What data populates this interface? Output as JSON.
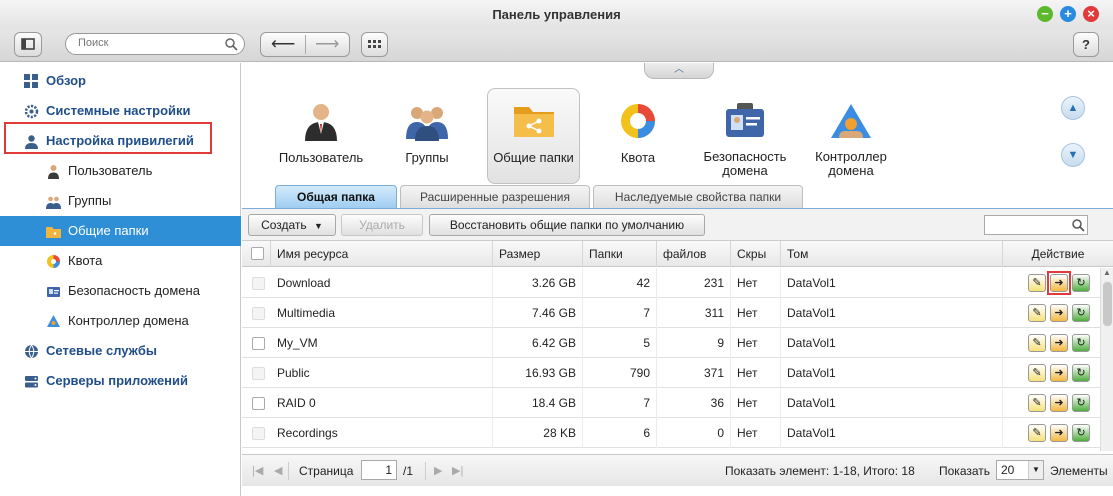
{
  "window": {
    "title": "Панель управления"
  },
  "toolbar": {
    "search_placeholder": "Поиск",
    "help_label": "?"
  },
  "sidebar": {
    "items": [
      {
        "label": "Обзор",
        "level": "top",
        "icon": "overview-grid-icon"
      },
      {
        "label": "Системные настройки",
        "level": "top",
        "icon": "gear-icon"
      },
      {
        "label": "Настройка привилегий",
        "level": "top",
        "icon": "user-icon",
        "highlighted": true
      },
      {
        "label": "Пользователь",
        "level": "sub",
        "icon": "user-icon"
      },
      {
        "label": "Группы",
        "level": "sub",
        "icon": "group-icon"
      },
      {
        "label": "Общие папки",
        "level": "sub",
        "icon": "shared-folder-icon",
        "active": true
      },
      {
        "label": "Квота",
        "level": "sub",
        "icon": "quota-pie-icon"
      },
      {
        "label": "Безопасность домена",
        "level": "sub",
        "icon": "domain-security-icon"
      },
      {
        "label": "Контроллер домена",
        "level": "sub",
        "icon": "domain-controller-icon"
      },
      {
        "label": "Сетевые службы",
        "level": "top",
        "icon": "globe-icon"
      },
      {
        "label": "Серверы приложений",
        "level": "top",
        "icon": "server-icon"
      }
    ]
  },
  "categories": [
    {
      "label": "Пользователь"
    },
    {
      "label": "Группы"
    },
    {
      "label": "Общие папки",
      "active": true
    },
    {
      "label": "Квота"
    },
    {
      "label_line1": "Безопасность",
      "label_line2": "домена"
    },
    {
      "label_line1": "Контроллер",
      "label_line2": "домена"
    }
  ],
  "tabs": [
    {
      "label": "Общая папка",
      "active": true
    },
    {
      "label": "Расширенные разрешения"
    },
    {
      "label": "Наследуемые свойства папки"
    }
  ],
  "actions": {
    "create_label": "Создать",
    "delete_label": "Удалить",
    "restore_label": "Восстановить общие папки по умолчанию"
  },
  "table": {
    "headers": [
      "Имя ресурса",
      "Размер",
      "Папки",
      "файлов",
      "Скры",
      "Том",
      "Действие"
    ],
    "rows": [
      {
        "name": "Download",
        "size": "3.26 GB",
        "folders": "42",
        "files": "231",
        "hidden": "Нет",
        "volume": "DataVol1",
        "checkbox_enabled": false
      },
      {
        "name": "Multimedia",
        "size": "7.46 GB",
        "folders": "7",
        "files": "311",
        "hidden": "Нет",
        "volume": "DataVol1",
        "checkbox_enabled": false
      },
      {
        "name": "My_VM",
        "size": "6.42 GB",
        "folders": "5",
        "files": "9",
        "hidden": "Нет",
        "volume": "DataVol1",
        "checkbox_enabled": true
      },
      {
        "name": "Public",
        "size": "16.93 GB",
        "folders": "790",
        "files": "371",
        "hidden": "Нет",
        "volume": "DataVol1",
        "checkbox_enabled": false
      },
      {
        "name": "RAID 0",
        "size": "18.4 GB",
        "folders": "7",
        "files": "36",
        "hidden": "Нет",
        "volume": "DataVol1",
        "checkbox_enabled": true
      },
      {
        "name": "Recordings",
        "size": "28 KB",
        "folders": "6",
        "files": "0",
        "hidden": "Нет",
        "volume": "DataVol1",
        "checkbox_enabled": false
      }
    ]
  },
  "pagination": {
    "page_label": "Страница",
    "page_value": "1",
    "page_total": "/1",
    "summary": "Показать элемент: 1-18, Итого: 18",
    "show_label": "Показать",
    "per_page": "20",
    "items_label": "Элементы"
  },
  "colors": {
    "accent": "#2e8fd6",
    "highlight_border": "#e03a3a"
  }
}
